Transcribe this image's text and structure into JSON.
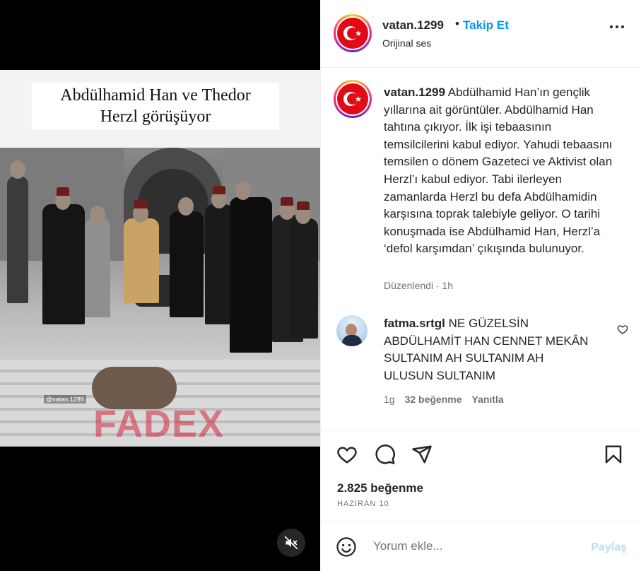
{
  "media": {
    "overlay_caption_line1": "Abdülhamid Han ve Thedor",
    "overlay_caption_line2": "Herzl görüşüyor",
    "watermark_handle": "@vatan.1299",
    "watermark_brand": "FADEX",
    "mute_icon": "speaker-muted-icon"
  },
  "header": {
    "username": "vatan.1299",
    "separator": "•",
    "follow_label": "Takip Et",
    "audio_label": "Orijinal ses",
    "more_icon": "more-horizontal-icon"
  },
  "caption": {
    "username": "vatan.1299",
    "text": "Abdülhamid Han’ın gençlik yıllarına ait görüntüler. Abdülhamid Han tahtına çıkıyor. İlk işi tebaasının temsilcilerini kabul ediyor. Yahudi tebaasını temsilen o dönem Gazeteci ve Aktivist olan Herzl’ı kabul ediyor. Tabi ilerleyen zamanlarda Herzl bu defa Abdülhamidin karşısına toprak talebiyle geliyor. O tarihi konuşmada ise Abdülhamid Han, Herzl’a ‘defol karşımdan’ çıkışında bulunuyor.",
    "edited_label": "Düzenlendi",
    "meta_separator": "·",
    "time": "1h"
  },
  "comment": {
    "username": "fatma.srtgl",
    "text": "NE GÜZELSİN ABDÜLHAMİT HAN CENNET MEKÂN SULTANIM AH SULTANIM AH ULUSUN SULTANIM",
    "time": "1g",
    "likes": "32 beğenme",
    "reply": "Yanıtla"
  },
  "actions": {
    "like_icon": "heart-icon",
    "comment_icon": "comment-icon",
    "share_icon": "send-icon",
    "save_icon": "bookmark-icon",
    "likes_count": "2.825 beğenme",
    "date": "HAZİRAN 10"
  },
  "compose": {
    "placeholder": "Yorum ekle...",
    "post_label": "Paylaş",
    "emoji_icon": "emoji-icon"
  },
  "colors": {
    "accent": "#0095f6",
    "post_disabled": "#b2dffc",
    "flag_red": "#e30a17"
  }
}
